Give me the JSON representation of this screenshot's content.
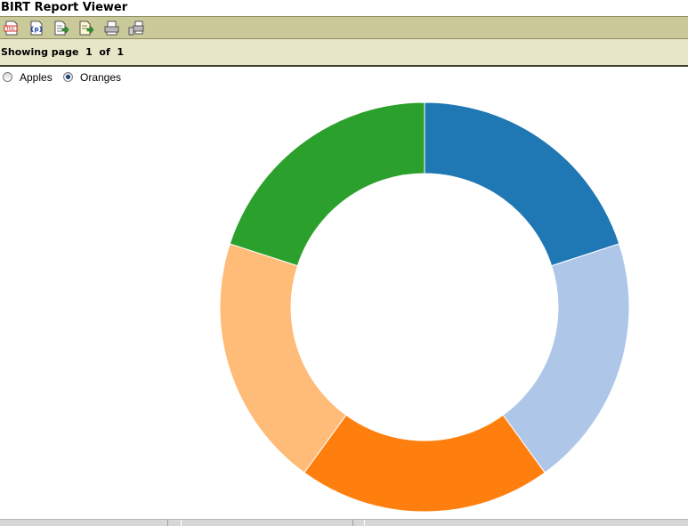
{
  "window": {
    "title": "BIRT Report Viewer"
  },
  "toolbar": {
    "buttons": [
      {
        "icon": "toc-icon",
        "badge": "TOC"
      },
      {
        "icon": "run-parameters-icon",
        "badge": "{p}"
      },
      {
        "icon": "export-data-icon"
      },
      {
        "icon": "export-report-icon"
      },
      {
        "icon": "print-icon"
      },
      {
        "icon": "print-server-icon"
      }
    ]
  },
  "navigation": {
    "page_info": "Showing page  1  of  1"
  },
  "selector": {
    "options": [
      {
        "label": "Apples",
        "selected": false
      },
      {
        "label": "Oranges",
        "selected": true
      }
    ]
  },
  "chart_data": {
    "type": "pie",
    "style": "donut",
    "slices": [
      {
        "value": 20,
        "color": "#1f77b4"
      },
      {
        "value": 20,
        "color": "#aec7e8"
      },
      {
        "value": 20,
        "color": "#ff7f0e"
      },
      {
        "value": 20,
        "color": "#ffbb78"
      },
      {
        "value": 20,
        "color": "#2ca02c"
      }
    ],
    "start": "top",
    "direction": "clockwise"
  }
}
